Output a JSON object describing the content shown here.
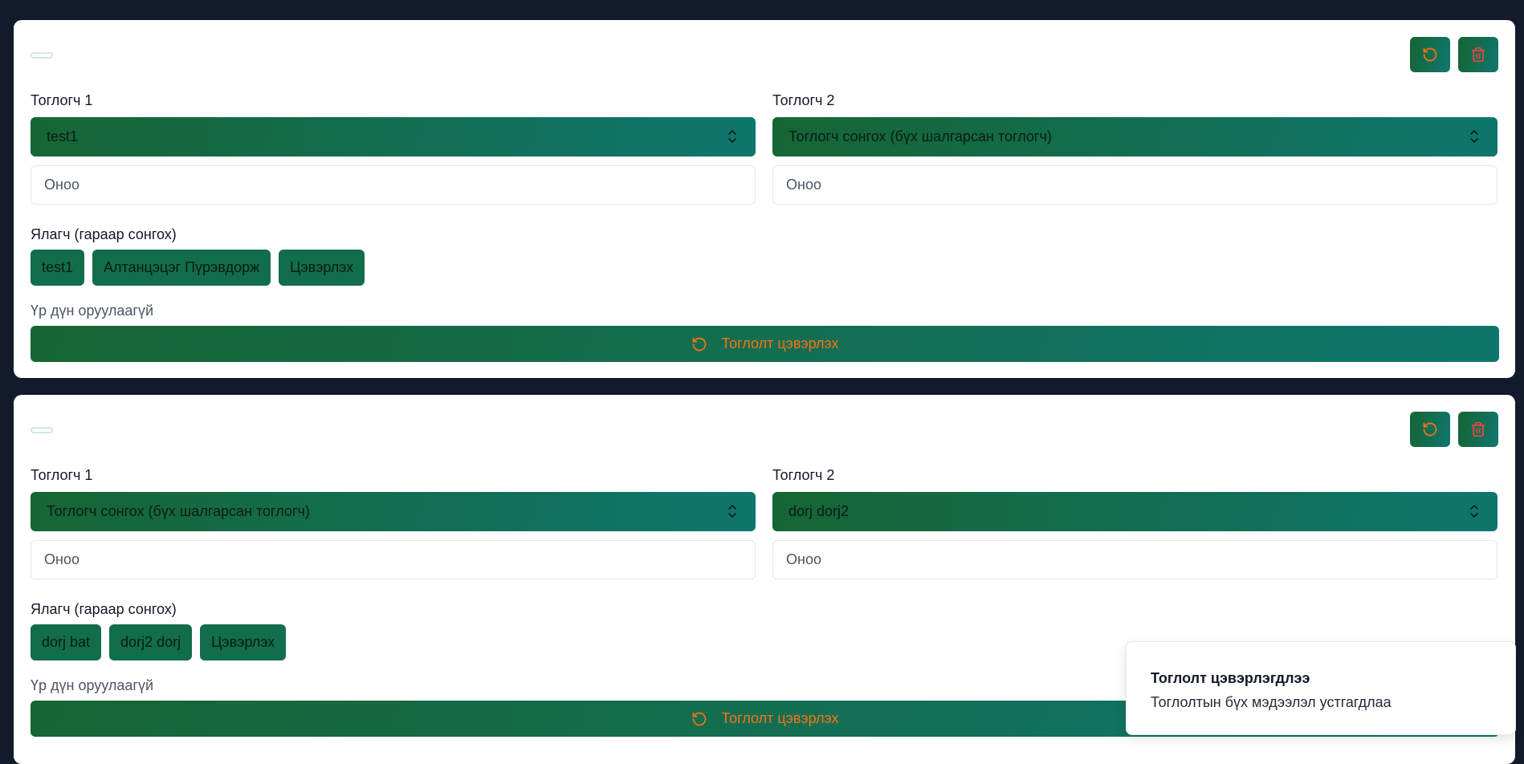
{
  "colors": {
    "page_bg": "#131a2b",
    "card_bg": "#ffffff",
    "accent_gradient_start": "#166534",
    "accent_gradient_end": "#0f766e",
    "reset_icon": "#f97316",
    "delete_icon": "#ef4444"
  },
  "matches": [
    {
      "player1_label": "Тоглогч 1",
      "player2_label": "Тоглогч 2",
      "player1_value": "test1",
      "player2_value": "Тоглогч сонгох (бүх шалгарсан тоглогч)",
      "score1_placeholder": "Оноо",
      "score2_placeholder": "Оноо",
      "winner_label": "Ялагч (гараар сонгох)",
      "winner_options": [
        "test1",
        "Алтанцэцэг Пүрэвдорж",
        "Цэвэрлэх"
      ],
      "status": "Үр дүн оруулаагүй",
      "reset_label": "Тоглолт цэвэрлэх"
    },
    {
      "player1_label": "Тоглогч 1",
      "player2_label": "Тоглогч 2",
      "player1_value": "Тоглогч сонгох (бүх шалгарсан тоглогч)",
      "player2_value": "dorj dorj2",
      "score1_placeholder": "Оноо",
      "score2_placeholder": "Оноо",
      "winner_label": "Ялагч (гараар сонгох)",
      "winner_options": [
        "dorj bat",
        "dorj2 dorj",
        "Цэвэрлэх"
      ],
      "status": "Үр дүн оруулаагүй",
      "reset_label": "Тоглолт цэвэрлэх"
    }
  ],
  "icons": {
    "reset": "rotate-ccw-icon",
    "delete": "trash-icon",
    "select": "chevrons-up-down-icon"
  },
  "toast": {
    "title": "Тоглолт цэвэрлэгдлээ",
    "message": "Тоглолтын бүх мэдээлэл устгагдлаа"
  }
}
